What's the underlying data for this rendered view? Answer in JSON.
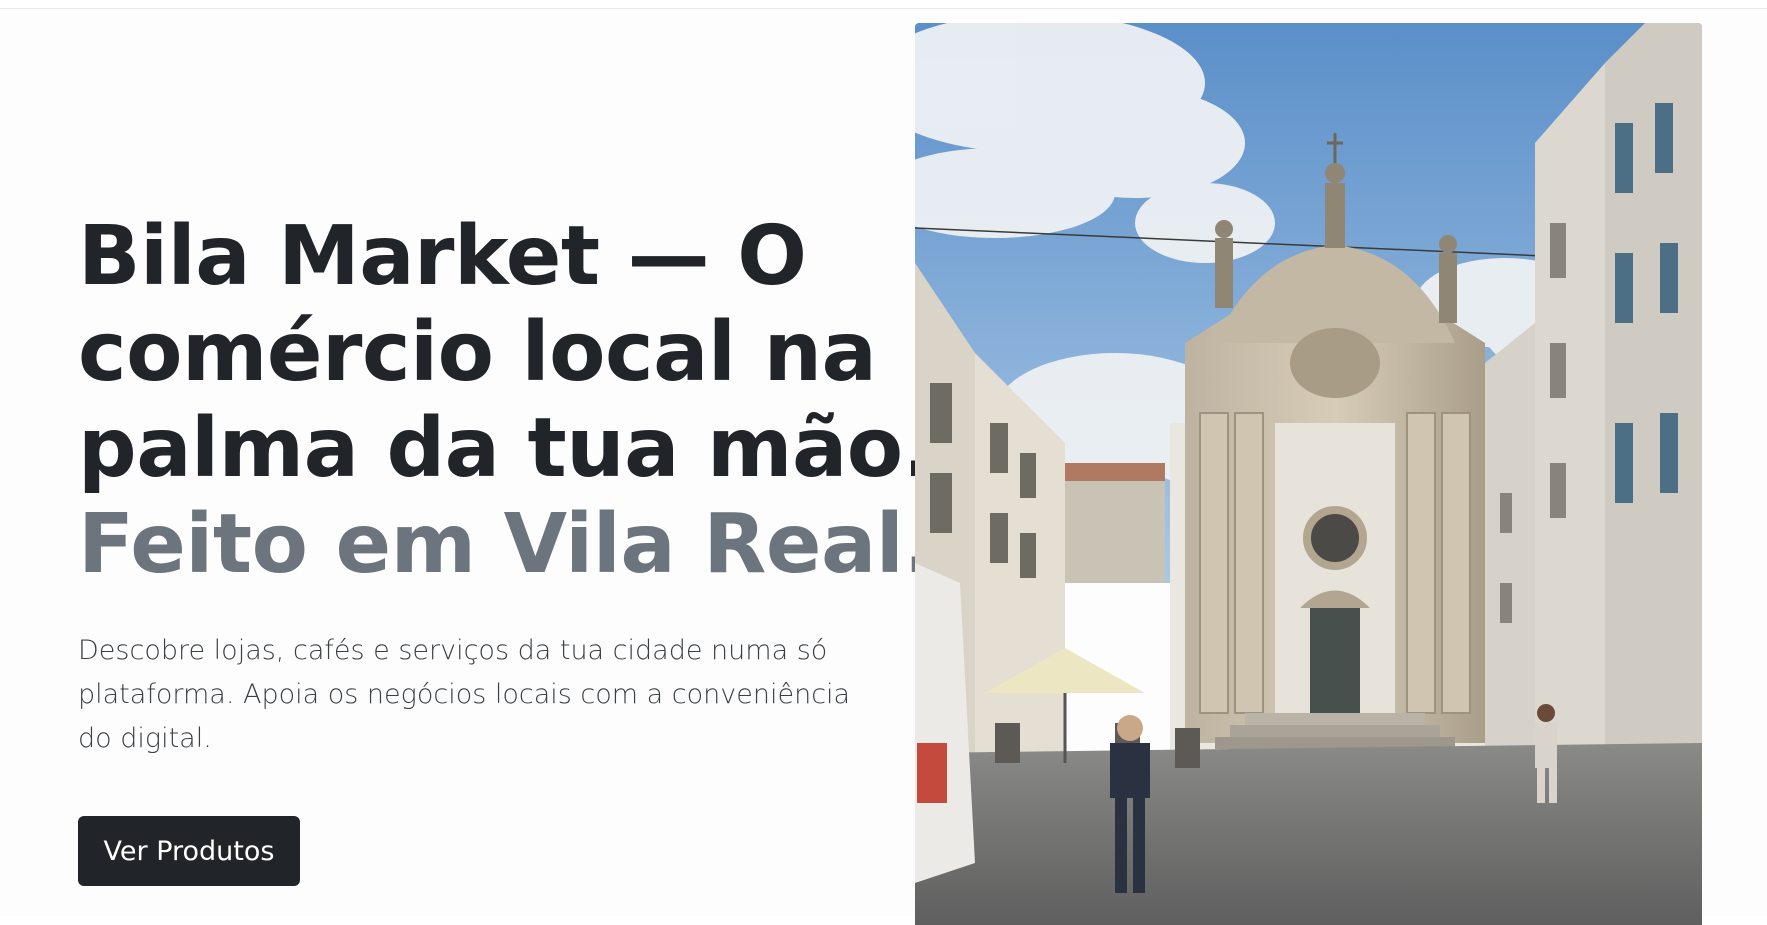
{
  "hero": {
    "title_line1": "Bila Market — O",
    "title_line2": "comércio local na",
    "title_line3": "palma da tua mão.",
    "title_highlight": "Feito em Vila Real.",
    "lead": "Descobre lojas, cafés e serviços da tua cidade numa só plataforma. Apoia os negócios locais com a conveniência do digital.",
    "cta_label": "Ver Produtos"
  },
  "colors": {
    "primary_text": "#212529",
    "muted_text": "#6c757d",
    "button_bg": "#212529",
    "button_text": "#ffffff"
  }
}
